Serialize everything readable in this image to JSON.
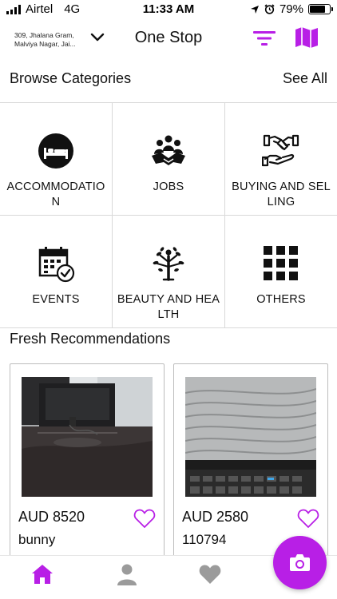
{
  "status_bar": {
    "carrier": "Airtel",
    "network": "4G",
    "time": "11:33 AM",
    "battery": "79%",
    "battery_level": 0.79
  },
  "header": {
    "location_line1": "309, Jhalana Gram,",
    "location_line2": "Malviya Nagar, Jai...",
    "title": "One Stop",
    "accent_color": "#b81fe6"
  },
  "browse": {
    "title": "Browse Categories",
    "see_all": "See All",
    "categories": [
      {
        "label": "ACCOMMODATION",
        "icon": "bed-icon"
      },
      {
        "label": "JOBS",
        "icon": "team-handshake-icon"
      },
      {
        "label": "BUYING AND SELLING",
        "icon": "hands-exchange-icon"
      },
      {
        "label": "EVENTS",
        "icon": "calendar-check-icon"
      },
      {
        "label": "BEAUTY AND HEALTH",
        "icon": "tree-person-icon"
      },
      {
        "label": "OTHERS",
        "icon": "grid-icon"
      }
    ]
  },
  "recommendations": {
    "title": "Fresh Recommendations",
    "items": [
      {
        "price": "AUD 8520",
        "name": "bunny",
        "image": "monitor-photo"
      },
      {
        "price": "AUD 2580",
        "name": "110794",
        "image": "laptop-screen-photo"
      }
    ]
  },
  "bottom_nav": {
    "items": [
      {
        "name": "home-icon",
        "active": true
      },
      {
        "name": "profile-icon",
        "active": false
      },
      {
        "name": "favorites-icon",
        "active": false
      }
    ],
    "fab_icon": "camera-icon"
  }
}
